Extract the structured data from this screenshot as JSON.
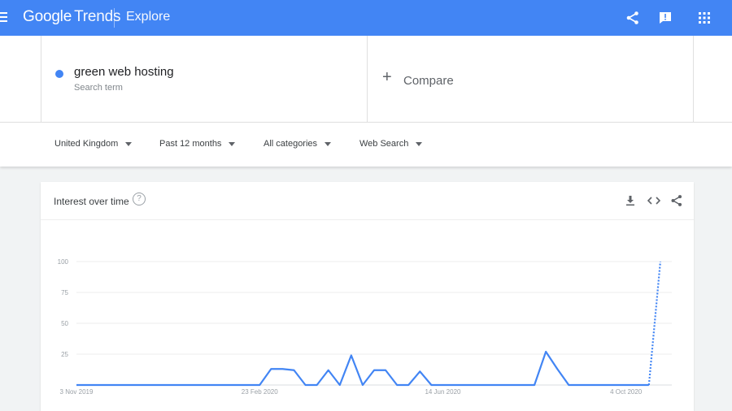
{
  "header": {
    "logo_google": "Google",
    "logo_trends": "Trends",
    "section": "Explore",
    "icons": [
      "menu-icon",
      "share-icon",
      "feedback-icon",
      "apps-icon"
    ]
  },
  "search": {
    "term": "green web hosting",
    "term_subtitle": "Search term",
    "term_color": "#4285f4",
    "compare_label": "Compare"
  },
  "filters": {
    "region": "United Kingdom",
    "time_range": "Past 12 months",
    "category": "All categories",
    "search_type": "Web Search"
  },
  "chart": {
    "title": "Interest over time",
    "help_glyph": "?",
    "icons": [
      "download-icon",
      "embed-icon",
      "share-icon"
    ]
  },
  "chart_data": {
    "type": "line",
    "title": "Interest over time",
    "xlabel": "",
    "ylabel": "",
    "ylim": [
      0,
      100
    ],
    "y_ticks": [
      100,
      75,
      50,
      25
    ],
    "x_range": [
      0,
      52
    ],
    "x_tick_labels": [
      {
        "x": 0,
        "label": "3 Nov 2019"
      },
      {
        "x": 16,
        "label": "23 Feb 2020"
      },
      {
        "x": 32,
        "label": "14 Jun 2020"
      },
      {
        "x": 48,
        "label": "4 Oct 2020"
      }
    ],
    "grid": true,
    "series": [
      {
        "color": "#4285f4",
        "values": [
          0,
          0,
          0,
          0,
          0,
          0,
          0,
          0,
          0,
          0,
          0,
          0,
          0,
          0,
          0,
          0,
          0,
          13,
          13,
          12,
          0,
          0,
          12,
          0,
          24,
          0,
          12,
          12,
          0,
          0,
          11,
          0,
          0,
          0,
          0,
          0,
          0,
          0,
          0,
          0,
          0,
          27,
          13,
          0,
          0,
          0,
          0,
          0,
          0,
          0,
          0,
          100
        ],
        "partial_from_index": 50
      }
    ]
  }
}
